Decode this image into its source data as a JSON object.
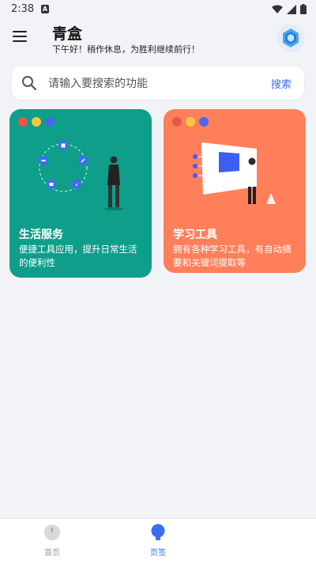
{
  "status": {
    "time": "2:38",
    "badge": "A"
  },
  "header": {
    "title": "青盒",
    "greeting": "下午好！稍作休息，为胜利继续前行！"
  },
  "search": {
    "placeholder": "请输入要搜索的功能",
    "button": "搜索"
  },
  "cards": [
    {
      "title": "生活服务",
      "desc": "便捷工具应用，提升日常生活的便利性",
      "color": "#0f9e89"
    },
    {
      "title": "学习工具",
      "desc": "拥有各种学习工具，有自动摘要和关键词提取等",
      "color": "#ff7f5a"
    }
  ],
  "dots": [
    "#e8554e",
    "#f5c842",
    "#4a66f0"
  ],
  "nav": [
    {
      "label": "首页",
      "icon": "clock-icon"
    },
    {
      "label": "页签",
      "icon": "bulb-icon",
      "active": true
    }
  ],
  "colors": {
    "accent": "#3a6df0",
    "background": "#f2f3f7"
  }
}
